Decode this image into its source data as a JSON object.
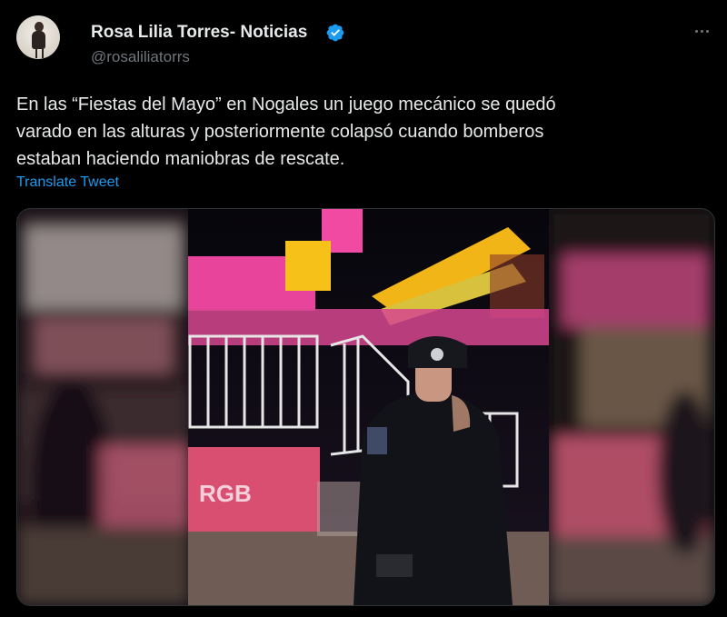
{
  "author": {
    "display_name": "Rosa Lilia Torres- Noticias",
    "handle": "@rosaliliatorrs",
    "verified": true,
    "avatar_icon": "avatar-photo"
  },
  "tweet": {
    "text_lines": [
      "En las “Fiestas del Mayo” en Nogales un juego mecánico se quedó",
      "varado en las alturas y posteriormente colapsó cuando bomberos",
      "estaban haciendo maniobras de rescate."
    ],
    "translate_label": "Translate Tweet"
  },
  "media": {
    "type": "video-still",
    "banner_text": "RGB"
  },
  "icons": {
    "verified": "verified-badge-icon",
    "more": "more-options-icon"
  },
  "colors": {
    "background": "#000000",
    "text": "#e7e9ea",
    "secondary": "#71767b",
    "link": "#1d9bf0",
    "verified": "#1d9bf0"
  }
}
